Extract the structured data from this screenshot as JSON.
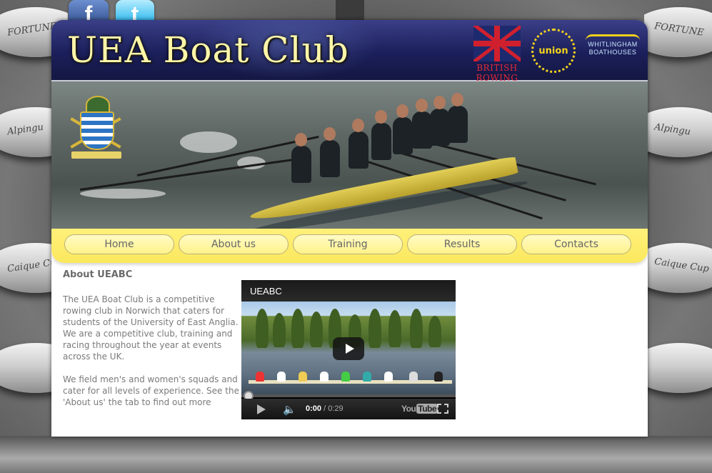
{
  "social": {
    "facebook_letter": "f",
    "twitter_letter": "t"
  },
  "header": {
    "title": "UEA Boat Club",
    "logos": {
      "british_rowing": "BRITISH ROWING",
      "union": "union",
      "whitlingham_line1": "WHITLINGHAM",
      "whitlingham_line2": "BOATHOUSES"
    }
  },
  "background": {
    "left_boats": [
      "FORTUNE",
      "Alpingu",
      "Caique Cup"
    ],
    "right_boats": [
      "FORTUNE",
      "Alpingu",
      "Caique Cup"
    ]
  },
  "nav": {
    "items": [
      {
        "label": "Home"
      },
      {
        "label": "About us"
      },
      {
        "label": "Training"
      },
      {
        "label": "Results"
      },
      {
        "label": "Contacts"
      }
    ]
  },
  "content": {
    "heading": "About UEABC",
    "paragraph1": "The UEA Boat Club is a competitive rowing club in Norwich that caters for students of the University of East Anglia. We are a competitive club, training and racing throughout the year at events across the UK.",
    "paragraph2": "We field men's and women's squads and cater for all levels of experience. See the 'About us' the tab to find out more"
  },
  "video": {
    "title": "UEABC",
    "current_time": "0:00",
    "separator": " / ",
    "duration": "0:29",
    "brand": "You",
    "brand_tube": "Tube",
    "progress": 0
  },
  "colors": {
    "header_bg": "#1b1f5a",
    "title_color": "#fff6a8",
    "nav_yellow": "#fbe85e",
    "british_rowing_red": "#e02a38",
    "union_gold": "#f4d21a"
  }
}
